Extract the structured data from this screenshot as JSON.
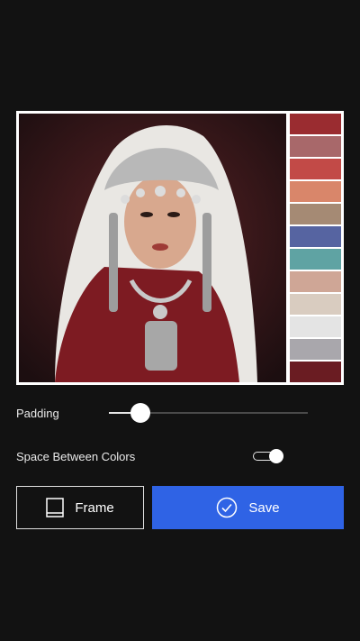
{
  "photo": {
    "alt_icon": "portrait-photo"
  },
  "palette": {
    "colors": [
      "#9a2c30",
      "#a8686a",
      "#c24a47",
      "#d9866a",
      "#a58a74",
      "#5664a1",
      "#5fa3a3",
      "#cfa696",
      "#d9ccc0",
      "#e4e4e4",
      "#a9a7ac",
      "#6a1c22"
    ]
  },
  "controls": {
    "padding_label": "Padding",
    "padding_value": 0.16,
    "spacing_label": "Space Between Colors",
    "spacing_on": true
  },
  "buttons": {
    "frame_label": "Frame",
    "frame_icon": "frame-icon",
    "save_label": "Save",
    "save_icon": "check-circle-icon"
  },
  "colors": {
    "background": "#121212",
    "accent": "#2f63e5"
  }
}
